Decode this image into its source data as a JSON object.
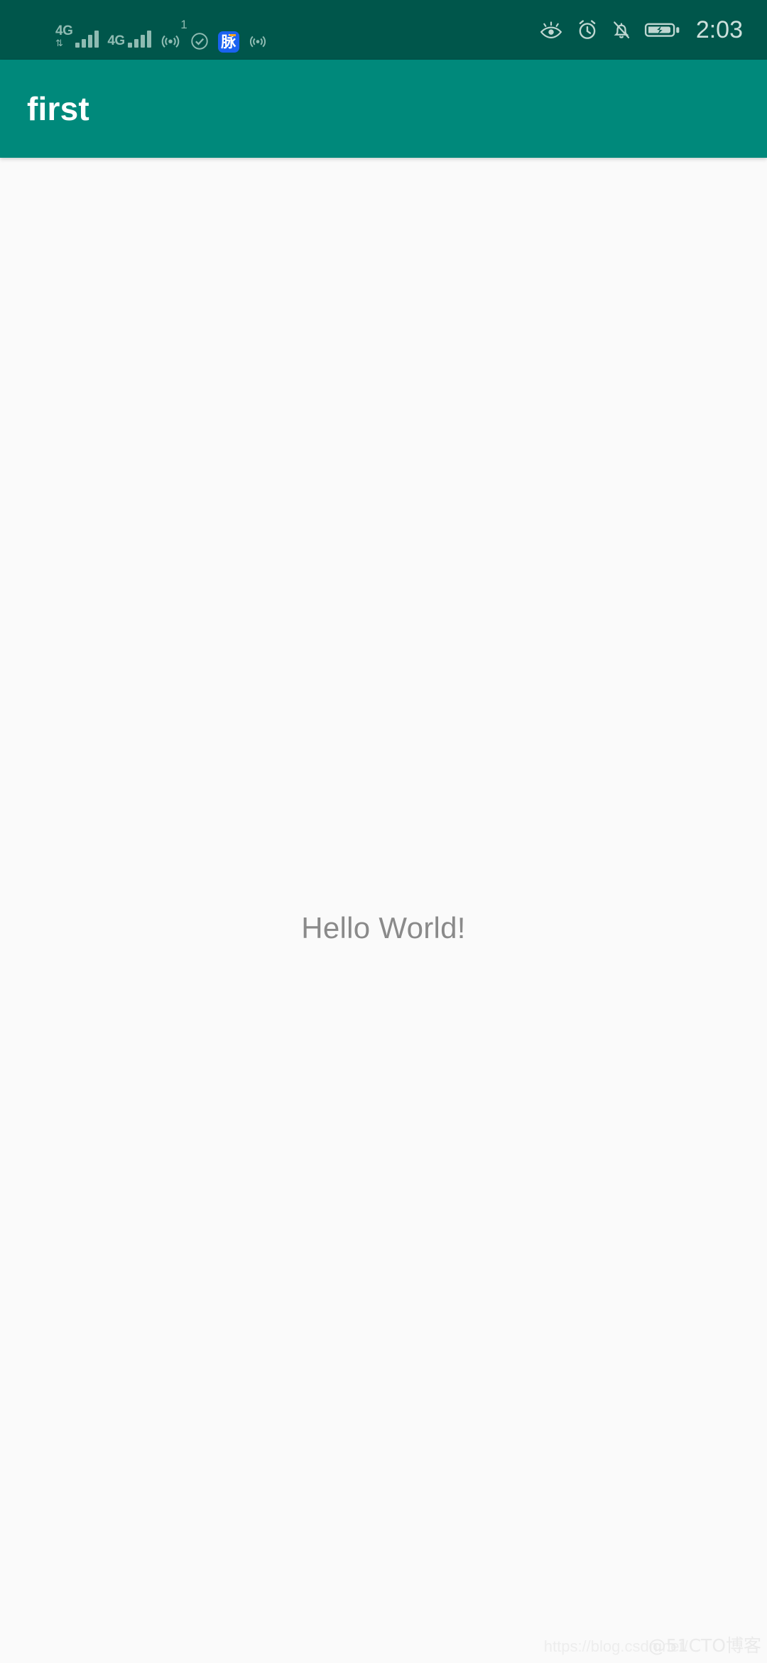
{
  "status_bar": {
    "background_color": "#00564B",
    "icon_color": "#8FBBB2",
    "time": "2:03",
    "left_icons": [
      {
        "name": "signal-4g-sim1",
        "label": "4G",
        "sublabel": "⇅",
        "bars": 4
      },
      {
        "name": "signal-4g-sim2",
        "label": "4G",
        "sublabel": "",
        "bars": 4
      },
      {
        "name": "hotspot-icon",
        "superscript": "1"
      },
      {
        "name": "check-circle-icon"
      },
      {
        "name": "maimai-app-icon",
        "glyph": "脉",
        "badge_color": "#1A62F0"
      },
      {
        "name": "wifi-point-icon"
      }
    ],
    "right_icons": [
      {
        "name": "eye-comfort-icon"
      },
      {
        "name": "alarm-clock-icon"
      },
      {
        "name": "bell-muted-icon"
      },
      {
        "name": "battery-charging-icon"
      }
    ]
  },
  "app_bar": {
    "title": "first",
    "background_color": "#00897B",
    "title_color": "#FFFFFF"
  },
  "content": {
    "hello_text": "Hello World!",
    "text_color": "#8A8A8A",
    "background_color": "#FAFAFA"
  },
  "watermark": {
    "url": "https://blog.csdn.net/",
    "tag": "@51CTO博客"
  }
}
